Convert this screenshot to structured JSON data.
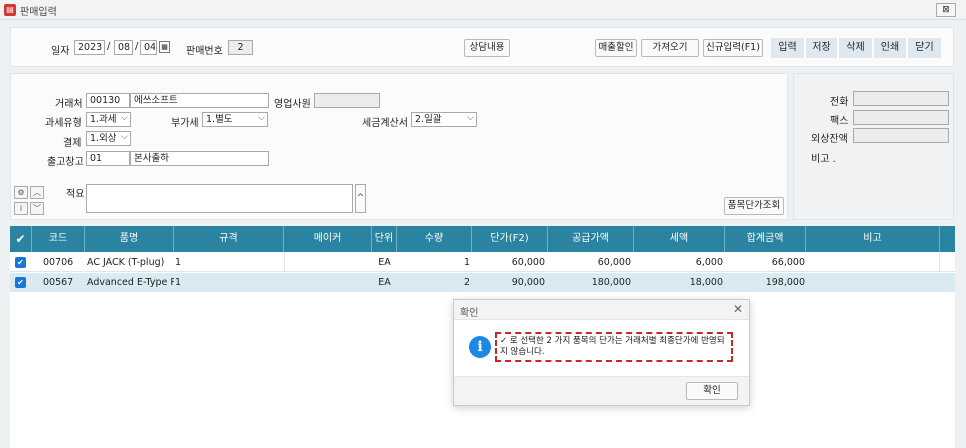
{
  "window": {
    "title": "판매입력",
    "close": "⊠"
  },
  "header": {
    "date_label": "일자",
    "year": "2023",
    "month": "08",
    "day": "04",
    "sale_no_label": "판매번호",
    "sale_no": "2",
    "consult_btn": "상담내용",
    "btn_discount": "매출할인",
    "btn_import": "가져오기",
    "btn_new": "신규입력(F1)",
    "actions": [
      "입력",
      "저장",
      "삭제",
      "인쇄",
      "닫기"
    ]
  },
  "form": {
    "client_label": "거래처",
    "client_code": "00130",
    "client_name": "에쓰소프트",
    "sales_rep_label": "영업사원",
    "tax_type_label": "과세유형",
    "tax_type": "1.과세",
    "vat_label": "부가세",
    "vat": "1.별도",
    "invoice_label": "세금계산서",
    "invoice": "2.일괄",
    "payment_label": "결제",
    "payment": "1.외상",
    "warehouse_label": "출고창고",
    "warehouse_code": "01",
    "warehouse_name": "본사출하",
    "memo_label": "적요",
    "price_lookup_btn": "품목단가조회"
  },
  "side": {
    "phone_label": "전화",
    "fax_label": "팩스",
    "balance_label": "외상잔액",
    "note_label": "비고 ."
  },
  "grid": {
    "columns": [
      "코드",
      "품명",
      "규격",
      "메이커",
      "단위",
      "수량",
      "단가(F2)",
      "공급가액",
      "세액",
      "합계금액",
      "비고"
    ],
    "rows": [
      {
        "code": "00706",
        "name": "AC JACK  (T-plug)",
        "spec": "1",
        "maker": "",
        "unit": "EA",
        "qty": "1",
        "price": "60,000",
        "supply": "60,000",
        "tax": "6,000",
        "total": "66,000",
        "note": ""
      },
      {
        "code": "00567",
        "name": "Advanced E-Type PC",
        "spec": "1",
        "maker": "",
        "unit": "EA",
        "qty": "2",
        "price": "90,000",
        "supply": "180,000",
        "tax": "18,000",
        "total": "198,000",
        "note": ""
      }
    ]
  },
  "dialog": {
    "title": "확인",
    "message": "✓ 로 선택한 2 가지 품목의 단가는 거래처별 최종단가에 반영되지 않습니다.",
    "ok": "확인"
  }
}
